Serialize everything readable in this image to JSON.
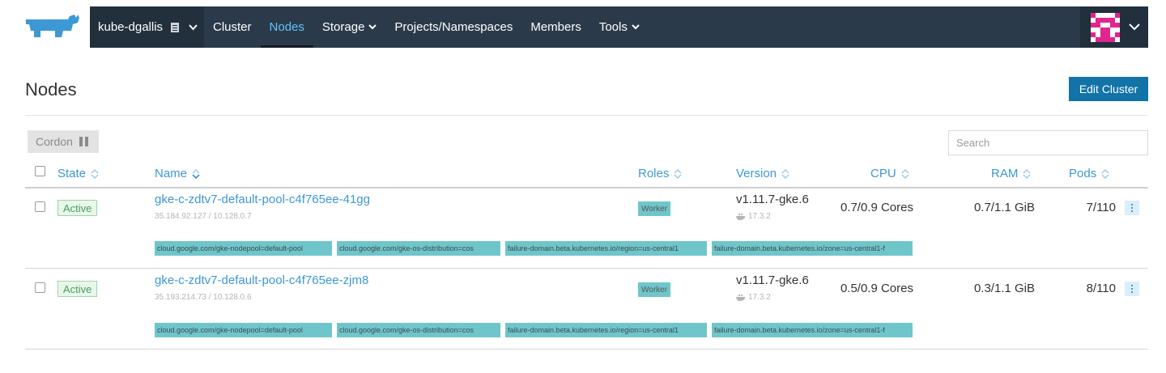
{
  "nav": {
    "cluster_name": "kube-dgallis",
    "items": [
      {
        "label": "Cluster"
      },
      {
        "label": "Nodes"
      },
      {
        "label": "Storage"
      },
      {
        "label": "Projects/Namespaces"
      },
      {
        "label": "Members"
      },
      {
        "label": "Tools"
      }
    ],
    "active_color": "#5cc4ff",
    "background": "#2b3a4a"
  },
  "page": {
    "title": "Nodes",
    "edit_button": "Edit Cluster",
    "cordon_button": "Cordon",
    "search_placeholder": "Search"
  },
  "table": {
    "headers": {
      "state": "State",
      "name": "Name",
      "roles": "Roles",
      "version": "Version",
      "cpu": "CPU",
      "ram": "RAM",
      "pods": "Pods"
    },
    "rows": [
      {
        "state": "Active",
        "name": "gke-c-zdtv7-default-pool-c4f765ee-41gg",
        "ips": "35.184.92.127  /  10.128.0.7",
        "role": "Worker",
        "version": "v1.11.7-gke.6",
        "docker": "17.3.2",
        "cpu": "0.7/0.9 Cores",
        "ram": "0.7/1.1 GiB",
        "pods": "7/110",
        "labels": [
          "cloud.google.com/gke-nodepool=default-pool",
          "cloud.google.com/gke-os-distribution=cos",
          "failure-domain.beta.kubernetes.io/region=us-central1",
          "failure-domain.beta.kubernetes.io/zone=us-central1-f"
        ]
      },
      {
        "state": "Active",
        "name": "gke-c-zdtv7-default-pool-c4f765ee-zjm8",
        "ips": "35.193.214.73  /  10.128.0.6",
        "role": "Worker",
        "version": "v1.11.7-gke.6",
        "docker": "17.3.2",
        "cpu": "0.5/0.9 Cores",
        "ram": "0.3/1.1 GiB",
        "pods": "8/110",
        "labels": [
          "cloud.google.com/gke-nodepool=default-pool",
          "cloud.google.com/gke-os-distribution=cos",
          "failure-domain.beta.kubernetes.io/region=us-central1",
          "failure-domain.beta.kubernetes.io/zone=us-central1-f"
        ]
      }
    ]
  }
}
